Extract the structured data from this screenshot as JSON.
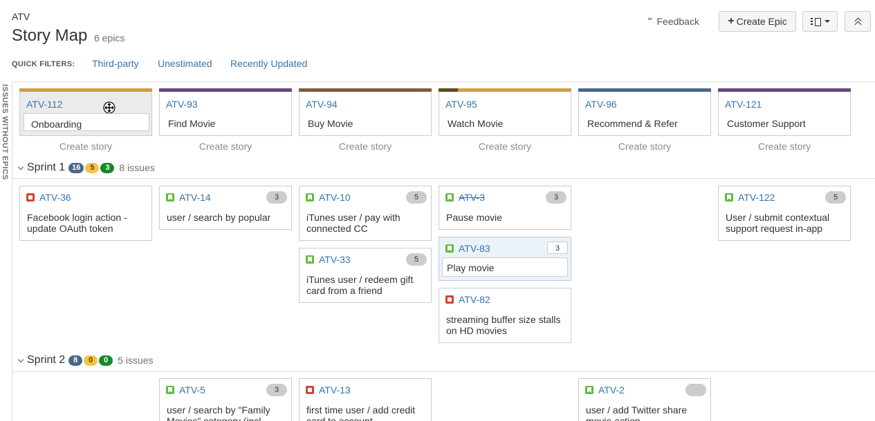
{
  "header": {
    "project_key": "ATV",
    "title": "Story Map",
    "epic_count": "6 epics",
    "feedback_label": "Feedback",
    "create_epic_label": "Create Epic"
  },
  "quick_filters": {
    "label": "QUICK FILTERS:",
    "items": [
      "Third-party",
      "Unestimated",
      "Recently Updated"
    ]
  },
  "side_label": "ISSUES WITHOUT EPICS",
  "create_story_label": "Create story",
  "epics": [
    {
      "key": "ATV-112",
      "name": "Onboarding",
      "color": "#d39c3f"
    },
    {
      "key": "ATV-93",
      "name": "Find Movie",
      "color": "#654982"
    },
    {
      "key": "ATV-94",
      "name": "Buy Movie",
      "color": "#815b3a"
    },
    {
      "key": "ATV-95",
      "name": "Watch Movie",
      "color": "#d39c3f"
    },
    {
      "key": "ATV-96",
      "name": "Recommend & Refer",
      "color": "#4a6785"
    },
    {
      "key": "ATV-121",
      "name": "Customer Support",
      "color": "#654982"
    }
  ],
  "sprints": [
    {
      "name": "Sprint 1",
      "counts": [
        "16",
        "5",
        "3"
      ],
      "issues": "8 issues"
    },
    {
      "name": "Sprint 2",
      "counts": [
        "8",
        "0",
        "0"
      ],
      "issues": "5 issues"
    }
  ],
  "cards": {
    "atv36": {
      "key": "ATV-36",
      "summary": "Facebook login action - update OAuth token",
      "type": "bug",
      "estimate": ""
    },
    "atv14": {
      "key": "ATV-14",
      "summary": "user / search by popular",
      "type": "story",
      "estimate": "3"
    },
    "atv10": {
      "key": "ATV-10",
      "summary": "iTunes user / pay with connected CC",
      "type": "story",
      "estimate": "5"
    },
    "atv33": {
      "key": "ATV-33",
      "summary": "iTunes user / redeem gift card from a friend",
      "type": "story",
      "estimate": "5"
    },
    "atv3": {
      "key": "ATV-3",
      "summary": "Pause movie",
      "type": "story",
      "estimate": "3"
    },
    "atv83": {
      "key": "ATV-83",
      "summary": "Play movie",
      "type": "story",
      "estimate": "3"
    },
    "atv82": {
      "key": "ATV-82",
      "summary": "streaming buffer size stalls on HD movies",
      "type": "bug",
      "estimate": ""
    },
    "atv122": {
      "key": "ATV-122",
      "summary": "User / submit contextual support request in-app",
      "type": "story",
      "estimate": "5"
    },
    "atv5": {
      "key": "ATV-5",
      "summary": "user / search by \"Family Movies\" category (incl.",
      "type": "story",
      "estimate": "3"
    },
    "atv13": {
      "key": "ATV-13",
      "summary": "first time user / add credit card to account",
      "type": "bug",
      "estimate": ""
    },
    "atv2": {
      "key": "ATV-2",
      "summary": "user / add Twitter share movie action",
      "type": "story",
      "estimate": ""
    }
  }
}
